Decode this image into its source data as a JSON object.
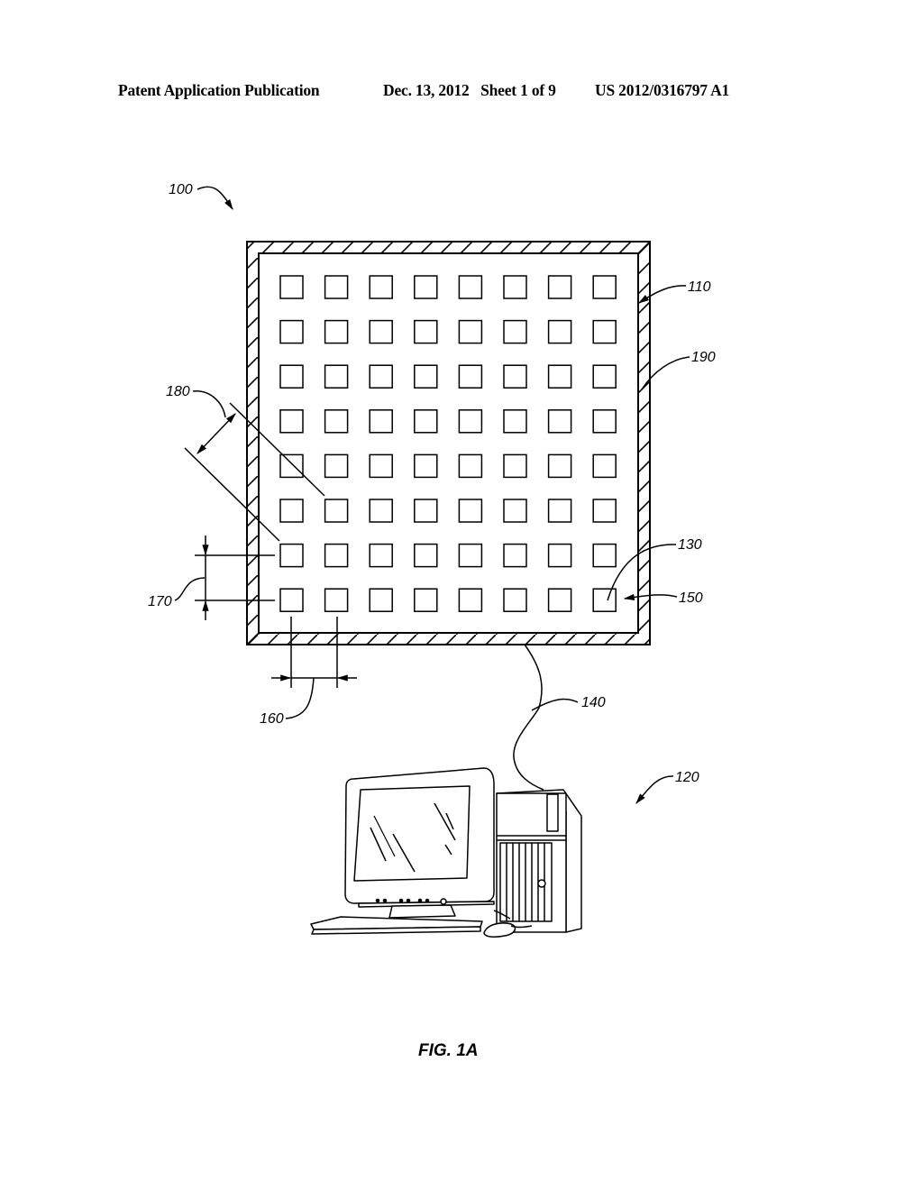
{
  "header": {
    "publication_type": "Patent Application Publication",
    "date_sheet": "Dec. 13, 2012   Sheet 1 of 9",
    "publication_number": "US 2012/0316797 A1"
  },
  "figure": {
    "caption": "FIG. 1A",
    "grid": {
      "rows": 8,
      "columns": 8
    },
    "reference_labels": {
      "system": "100",
      "panel": "110",
      "computer": "120",
      "element": "130",
      "cable": "140",
      "array": "150",
      "horizontal_pitch": "160",
      "vertical_pitch": "170",
      "diagonal_pitch": "180",
      "frame": "190"
    }
  }
}
